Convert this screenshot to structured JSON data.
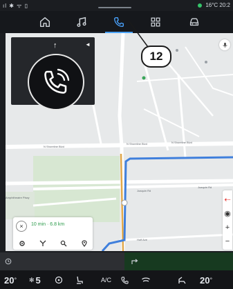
{
  "statusbar": {
    "left_icons": "ıl ✱ ᯤ ▯",
    "temperature": "16°C",
    "time": "20:2"
  },
  "topnav": {
    "items": [
      {
        "icon": "home-icon"
      },
      {
        "icon": "music-note-icon"
      },
      {
        "icon": "phone-icon"
      },
      {
        "icon": "apps-grid-icon"
      },
      {
        "icon": "car-icon"
      }
    ]
  },
  "map": {
    "road_labels": [
      "N Shoreline Blvd",
      "N Shoreline Blvd",
      "N Shoreline Blvd",
      "Amphitheatre Pkwy",
      "Joaquin Rd",
      "Joaquin Rd",
      "Huff Ave"
    ]
  },
  "callout": {
    "label": "12"
  },
  "route_card": {
    "close_label": "×",
    "eta": "10 min · 6.8 km"
  },
  "bottombar": {
    "left_temp": "20",
    "left_temp_suffix": "°",
    "fan_level": "5",
    "ac_label": "A/C",
    "right_temp": "20",
    "right_temp_suffix": "°"
  },
  "colors": {
    "accent": "#4aa3ff",
    "route": "#3f7fdc",
    "eta": "#2a9a4a",
    "status_dot": "#35c46a"
  }
}
